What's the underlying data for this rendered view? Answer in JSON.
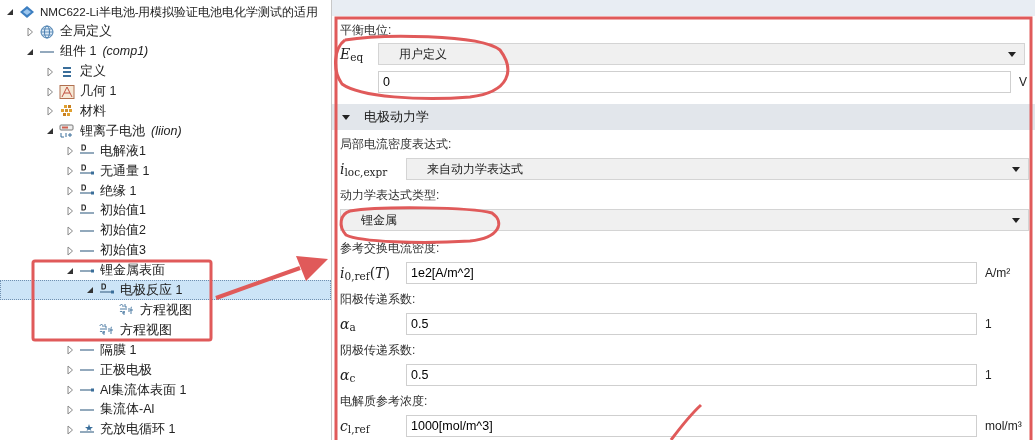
{
  "tree": [
    {
      "text": "NMC622-Li半电池-用模拟验证电池电化学测试的适用",
      "kind": "model",
      "expanded": true,
      "selected": false,
      "children": [
        {
          "text": "全局定义",
          "kind": "globe",
          "expanded": false,
          "selected": false
        },
        {
          "text": "组件 1",
          "tag": "(comp1)",
          "kind": "component",
          "expanded": true,
          "selected": false,
          "children": [
            {
              "text": "定义",
              "kind": "definitions",
              "expanded": false,
              "selected": false
            },
            {
              "text": "几何 1",
              "kind": "geometry",
              "expanded": false,
              "selected": false
            },
            {
              "text": "材料",
              "kind": "materials",
              "expanded": false,
              "selected": false
            },
            {
              "text": "锂离子电池",
              "tag": "(liion)",
              "kind": "battery",
              "expanded": true,
              "selected": false,
              "children": [
                {
                  "text": "电解液1",
                  "kind": "domain-default",
                  "expanded": false,
                  "selected": false
                },
                {
                  "text": "无通量 1",
                  "kind": "boundary-default",
                  "expanded": false,
                  "selected": false
                },
                {
                  "text": "绝缘 1",
                  "kind": "boundary-default",
                  "expanded": false,
                  "selected": false
                },
                {
                  "text": "初始值1",
                  "kind": "domain-default",
                  "expanded": false,
                  "selected": false
                },
                {
                  "text": "初始值2",
                  "kind": "domain",
                  "expanded": false,
                  "selected": false
                },
                {
                  "text": "初始值3",
                  "kind": "domain",
                  "expanded": false,
                  "selected": false
                },
                {
                  "text": "锂金属表面",
                  "kind": "boundary",
                  "expanded": true,
                  "selected": false,
                  "children": [
                    {
                      "text": "电极反应 1",
                      "kind": "boundary-default",
                      "expanded": true,
                      "selected": true,
                      "children": [
                        {
                          "text": "方程视图",
                          "kind": "equation",
                          "selected": false
                        }
                      ]
                    },
                    {
                      "text": "方程视图",
                      "kind": "equation",
                      "selected": false
                    }
                  ]
                },
                {
                  "text": "隔膜 1",
                  "kind": "domain",
                  "expanded": false,
                  "selected": false
                },
                {
                  "text": "正极电极",
                  "kind": "domain",
                  "expanded": false,
                  "selected": false
                },
                {
                  "text": "Al集流体表面 1",
                  "kind": "boundary",
                  "expanded": false,
                  "selected": false
                },
                {
                  "text": "集流体-Al",
                  "kind": "domain",
                  "expanded": false,
                  "selected": false
                },
                {
                  "text": "充放电循环 1",
                  "kind": "global",
                  "expanded": false,
                  "selected": false
                }
              ]
            }
          ]
        }
      ]
    }
  ],
  "settings": [
    {
      "fields": [
        {
          "kind": "label",
          "text": "平衡电位:"
        },
        {
          "kind": "select",
          "symbol": "*E*$_{eq}$",
          "value": "用户定义"
        },
        {
          "kind": "input",
          "value": "0",
          "unit": "V"
        }
      ]
    },
    {
      "title": "电极动力学",
      "expanded": true,
      "fields": [
        {
          "kind": "label",
          "text": "局部电流密度表达式:"
        },
        {
          "kind": "select",
          "symbol": "*i*$_{loc,expr}$",
          "value": "来自动力学表达式"
        },
        {
          "kind": "label",
          "text": "动力学表达式类型:"
        },
        {
          "kind": "select",
          "value": "锂金属"
        },
        {
          "kind": "label",
          "text": "参考交换电流密度:"
        },
        {
          "kind": "input",
          "symbol": "*i*$_{0,ref}$(*T*)",
          "value": "1e2[A/m^2]",
          "unit": "A/m²"
        },
        {
          "kind": "label",
          "text": "阳极传递系数:"
        },
        {
          "kind": "input",
          "symbol": "*α*$_{a}$",
          "value": "0.5",
          "unit": "1"
        },
        {
          "kind": "label",
          "text": "阴极传递系数:"
        },
        {
          "kind": "input",
          "symbol": "*α*$_{c}$",
          "value": "0.5",
          "unit": "1"
        },
        {
          "kind": "label",
          "text": "电解质参考浓度:"
        },
        {
          "kind": "input",
          "symbol": "*c*$_{l,ref}$",
          "value": "1000[mol/m^3]",
          "unit": "mol/m³"
        }
      ]
    }
  ]
}
